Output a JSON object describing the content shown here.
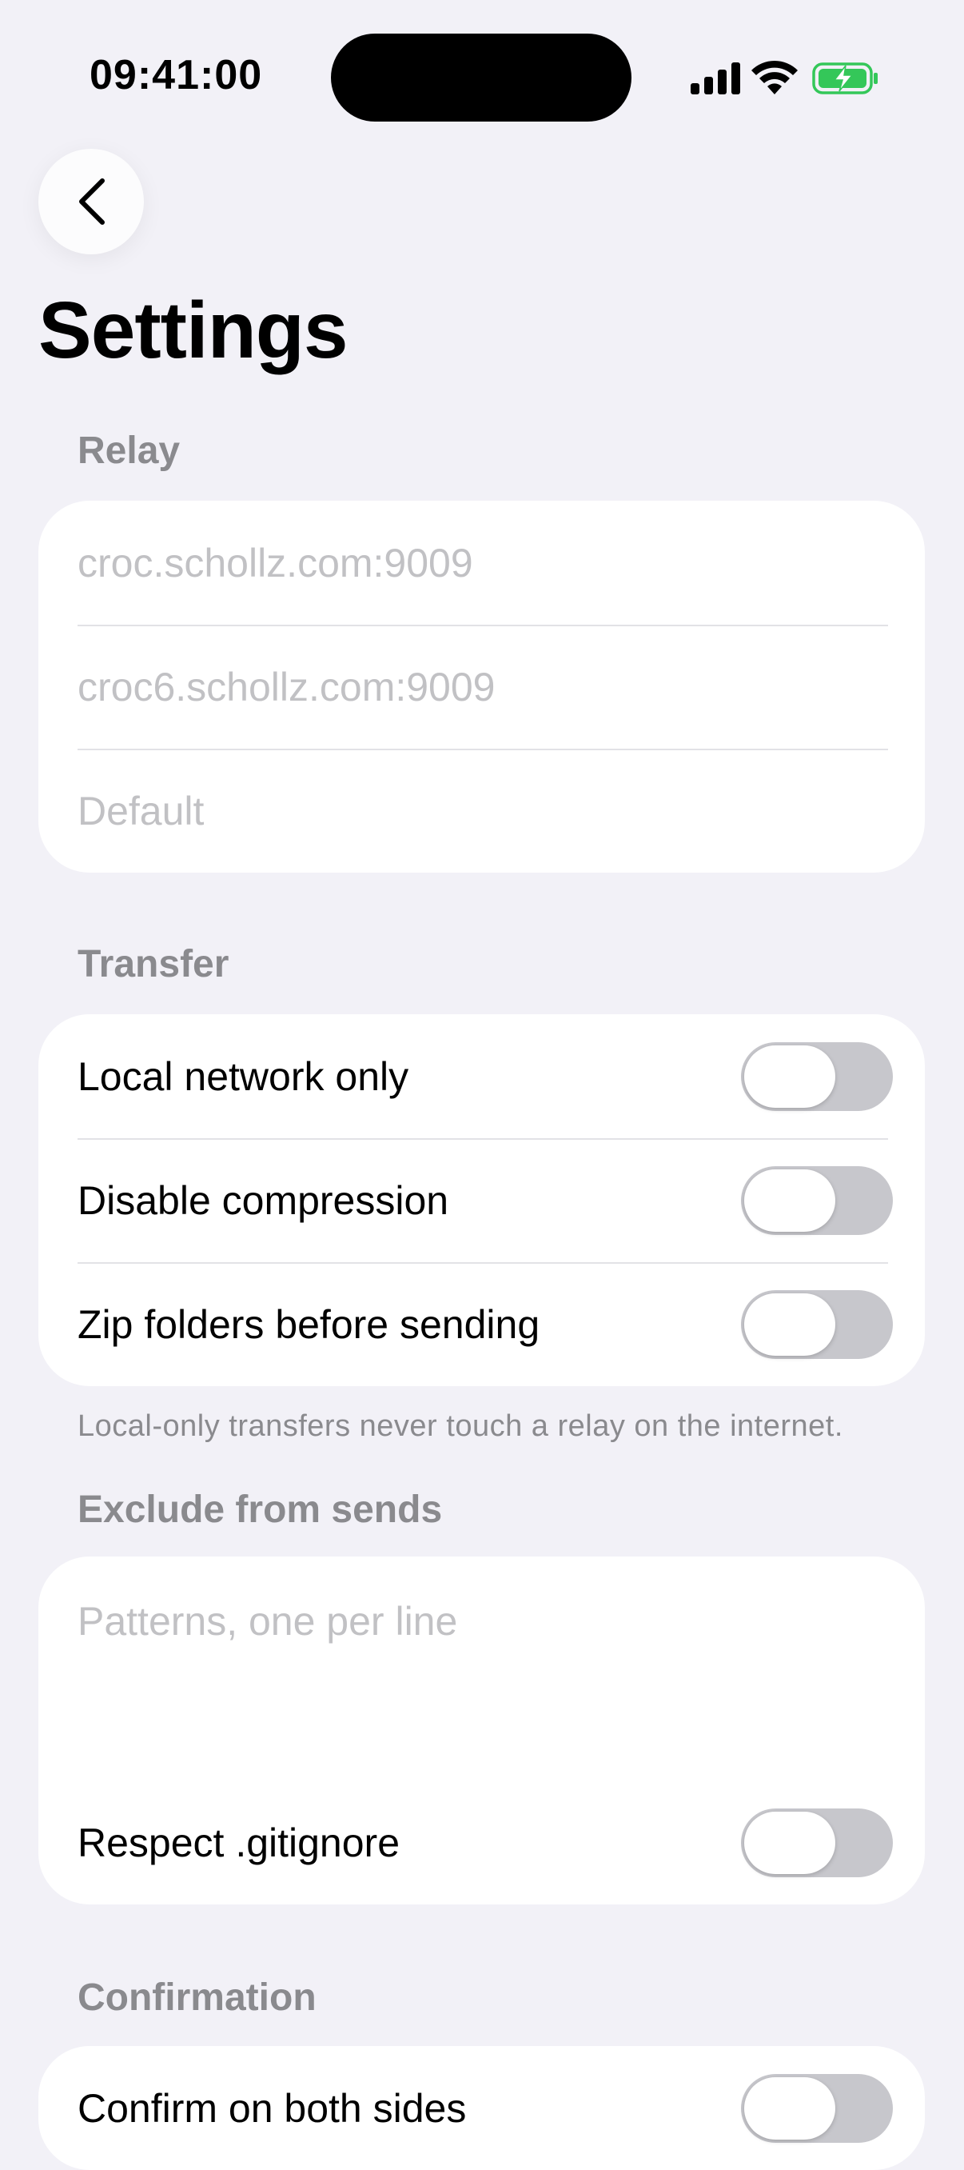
{
  "status_bar": {
    "time": "09:41:00"
  },
  "page": {
    "title": "Settings"
  },
  "relay": {
    "header": "Relay",
    "fields": [
      {
        "placeholder": "croc.schollz.com:9009"
      },
      {
        "placeholder": "croc6.schollz.com:9009"
      },
      {
        "placeholder": "Default"
      }
    ]
  },
  "transfer": {
    "header": "Transfer",
    "toggles": [
      {
        "label": "Local network only",
        "on": false
      },
      {
        "label": "Disable compression",
        "on": false
      },
      {
        "label": "Zip folders before sending",
        "on": false
      }
    ],
    "footer": "Local-only transfers never touch a relay on the internet."
  },
  "exclude": {
    "header": "Exclude from sends",
    "placeholder": "Patterns, one per line",
    "toggle": {
      "label": "Respect .gitignore",
      "on": false
    }
  },
  "confirmation": {
    "header": "Confirmation",
    "toggle": {
      "label": "Confirm on both sides",
      "on": false
    }
  },
  "colors": {
    "background": "#f2f1f7",
    "card": "#ffffff",
    "section_header": "#8a8a8e",
    "placeholder": "#c1c1c4",
    "toggle_off": "#c7c7cc",
    "battery_green": "#34c759"
  }
}
